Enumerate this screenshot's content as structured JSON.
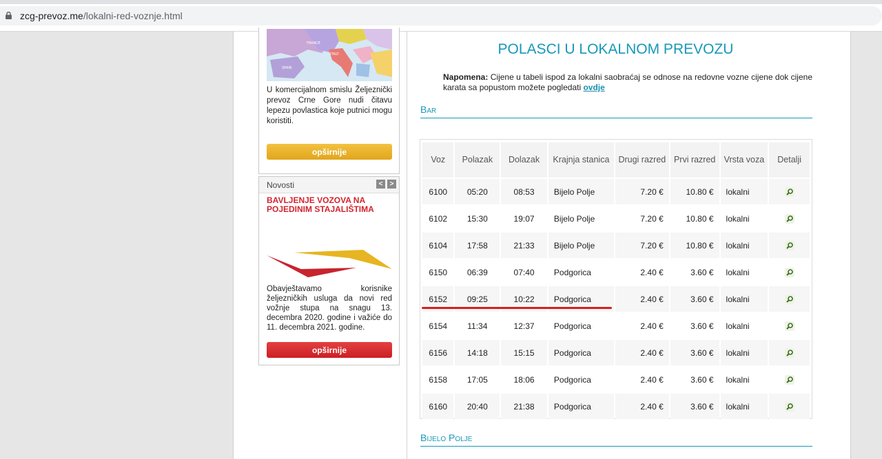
{
  "browser": {
    "url_domain": "zcg-prevoz.me",
    "url_path": "/lokalni-red-voznje.html"
  },
  "sidebar": {
    "map_labels": [
      "FRANCE",
      "ITALY",
      "SPAIN"
    ],
    "promo_text": "U komercijalnom smislu Željeznički prevoz Crne Gore nudi čitavu lepezu povlastica koje putnici mogu koristiti.",
    "promo_button": "opširnije",
    "news": {
      "header": "Novosti",
      "prev": "<",
      "next": ">",
      "title": "BAVLJENJE VOZOVA NA POJEDINIM STAJALIŠTIMA",
      "text": "Obavještavamo korisnike željezničkih usluga da novi red vožnje stupa na snagu 13. decembra 2020. godine i važiće do 11. decembra 2021. godine.",
      "button": "opširnije"
    }
  },
  "main": {
    "title": "POLASCI U LOKALNOM PREVOZU",
    "note_label": "Napomena:",
    "note_text": " Cijene u tabeli ispod za lokalni saobraćaj se odnose na redovne vozne cijene dok cijene karata sa popustom možete pogledati ",
    "note_link": "ovdje",
    "section_bar": "Bar",
    "section_bijelo_polje": "Bijelo Polje",
    "columns": [
      "Voz",
      "Polazak",
      "Dolazak",
      "Krajnja stanica",
      "Drugi razred",
      "Prvi razred",
      "Vrsta voza",
      "Detalji"
    ],
    "rows": [
      [
        "6100",
        "05:20",
        "08:53",
        "Bijelo Polje",
        "7.20 €",
        "10.80 €",
        "lokalni"
      ],
      [
        "6102",
        "15:30",
        "19:07",
        "Bijelo Polje",
        "7.20 €",
        "10.80 €",
        "lokalni"
      ],
      [
        "6104",
        "17:58",
        "21:33",
        "Bijelo Polje",
        "7.20 €",
        "10.80 €",
        "lokalni"
      ],
      [
        "6150",
        "06:39",
        "07:40",
        "Podgorica",
        "2.40 €",
        "3.60 €",
        "lokalni"
      ],
      [
        "6152",
        "09:25",
        "10:22",
        "Podgorica",
        "2.40 €",
        "3.60 €",
        "lokalni"
      ],
      [
        "6154",
        "11:34",
        "12:37",
        "Podgorica",
        "2.40 €",
        "3.60 €",
        "lokalni"
      ],
      [
        "6156",
        "14:18",
        "15:15",
        "Podgorica",
        "2.40 €",
        "3.60 €",
        "lokalni"
      ],
      [
        "6158",
        "17:05",
        "18:06",
        "Podgorica",
        "2.40 €",
        "3.60 €",
        "lokalni"
      ],
      [
        "6160",
        "20:40",
        "21:38",
        "Podgorica",
        "2.40 €",
        "3.60 €",
        "lokalni"
      ]
    ]
  },
  "colors": {
    "accent": "#1798b8",
    "news_red": "#d3232e",
    "highlight_red": "#d81e1e",
    "button_yellow": "#e8b02a",
    "button_red": "#d7272c"
  }
}
